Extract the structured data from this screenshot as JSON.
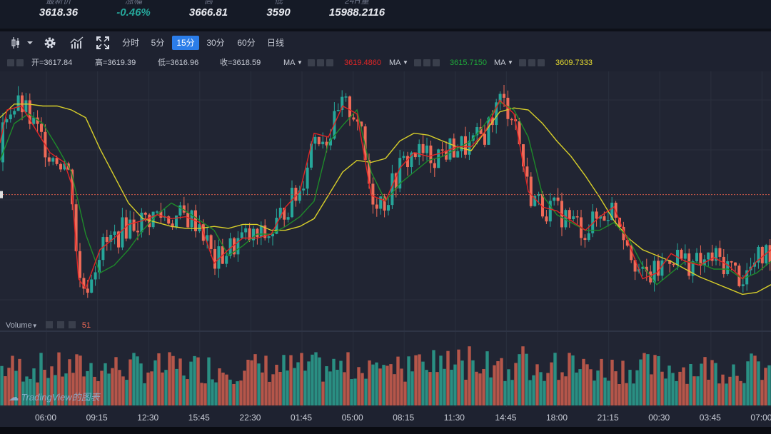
{
  "stats": [
    {
      "label": "最新价",
      "value": "3618.36",
      "cls": ""
    },
    {
      "label": "涨幅",
      "value": "-0.46%",
      "cls": "neg"
    },
    {
      "label": "高",
      "value": "3666.81",
      "cls": ""
    },
    {
      "label": "低",
      "value": "3590",
      "cls": ""
    },
    {
      "label": "24H量",
      "value": "15988.2116",
      "cls": ""
    }
  ],
  "toolbar": {
    "intervals": [
      "分时",
      "5分",
      "15分",
      "30分",
      "60分",
      "日线"
    ],
    "active_index": 2
  },
  "legend": {
    "open": "开=3617.84",
    "high": "高=3619.39",
    "low": "低=3616.96",
    "close": "收=3618.59",
    "ma_label": "MA",
    "ma1_value": "3619.4860",
    "ma2_value": "3615.7150",
    "ma3_value": "3609.7333"
  },
  "volume_legend": {
    "label": "Volume",
    "value": "51"
  },
  "watermark": "TradingView的图表",
  "colors": {
    "up": "#26a69a",
    "down": "#ef6a57",
    "ma1": "#e02626",
    "ma2": "#1e8a2a",
    "ma3": "#d8cf2a",
    "active_tab": "#2b7de9",
    "vol_up": "#2a8f83",
    "vol_down": "#b5564a"
  },
  "chart_data": {
    "type": "candlestick",
    "x_ticks": [
      "06:00",
      "09:15",
      "12:30",
      "15:45",
      "22:30",
      "01:45",
      "05:00",
      "08:15",
      "11:30",
      "14:45",
      "18:00",
      "21:15",
      "00:30",
      "03:45",
      "07:00"
    ],
    "ylim": [
      3555,
      3680
    ],
    "current_price": 3618.36,
    "ma1_path": [
      [
        0,
        3645
      ],
      [
        10,
        3662
      ],
      [
        30,
        3664
      ],
      [
        50,
        3652
      ],
      [
        70,
        3640
      ],
      [
        90,
        3635
      ],
      [
        100,
        3624
      ],
      [
        110,
        3575
      ],
      [
        120,
        3570
      ],
      [
        140,
        3590
      ],
      [
        160,
        3596
      ],
      [
        180,
        3603
      ],
      [
        200,
        3605
      ],
      [
        220,
        3608
      ],
      [
        240,
        3606
      ],
      [
        260,
        3607
      ],
      [
        280,
        3604
      ],
      [
        300,
        3583
      ],
      [
        320,
        3590
      ],
      [
        340,
        3596
      ],
      [
        360,
        3596
      ],
      [
        380,
        3598
      ],
      [
        400,
        3612
      ],
      [
        420,
        3620
      ],
      [
        440,
        3650
      ],
      [
        460,
        3648
      ],
      [
        480,
        3664
      ],
      [
        500,
        3660
      ],
      [
        520,
        3618
      ],
      [
        540,
        3615
      ],
      [
        560,
        3632
      ],
      [
        580,
        3640
      ],
      [
        600,
        3638
      ],
      [
        620,
        3640
      ],
      [
        640,
        3643
      ],
      [
        660,
        3643
      ],
      [
        680,
        3651
      ],
      [
        700,
        3667
      ],
      [
        720,
        3660
      ],
      [
        740,
        3620
      ],
      [
        760,
        3612
      ],
      [
        780,
        3610
      ],
      [
        800,
        3605
      ],
      [
        820,
        3600
      ],
      [
        840,
        3607
      ],
      [
        860,
        3612
      ],
      [
        880,
        3594
      ],
      [
        900,
        3575
      ],
      [
        920,
        3578
      ],
      [
        940,
        3588
      ],
      [
        960,
        3584
      ],
      [
        980,
        3582
      ],
      [
        1000,
        3586
      ],
      [
        1020,
        3582
      ],
      [
        1040,
        3575
      ],
      [
        1060,
        3584
      ],
      [
        1080,
        3590
      ]
    ],
    "ma2_path": [
      [
        0,
        3636
      ],
      [
        20,
        3655
      ],
      [
        40,
        3660
      ],
      [
        60,
        3655
      ],
      [
        80,
        3643
      ],
      [
        100,
        3630
      ],
      [
        120,
        3598
      ],
      [
        140,
        3578
      ],
      [
        160,
        3582
      ],
      [
        180,
        3590
      ],
      [
        200,
        3600
      ],
      [
        220,
        3608
      ],
      [
        240,
        3614
      ],
      [
        260,
        3610
      ],
      [
        280,
        3605
      ],
      [
        300,
        3600
      ],
      [
        320,
        3587
      ],
      [
        340,
        3592
      ],
      [
        360,
        3598
      ],
      [
        380,
        3598
      ],
      [
        400,
        3602
      ],
      [
        420,
        3607
      ],
      [
        440,
        3615
      ],
      [
        460,
        3645
      ],
      [
        480,
        3654
      ],
      [
        500,
        3662
      ],
      [
        520,
        3630
      ],
      [
        540,
        3615
      ],
      [
        560,
        3624
      ],
      [
        580,
        3630
      ],
      [
        600,
        3636
      ],
      [
        620,
        3638
      ],
      [
        640,
        3642
      ],
      [
        660,
        3646
      ],
      [
        680,
        3655
      ],
      [
        700,
        3666
      ],
      [
        720,
        3662
      ],
      [
        740,
        3648
      ],
      [
        760,
        3618
      ],
      [
        780,
        3608
      ],
      [
        800,
        3604
      ],
      [
        820,
        3600
      ],
      [
        840,
        3600
      ],
      [
        860,
        3604
      ],
      [
        880,
        3596
      ],
      [
        900,
        3582
      ],
      [
        920,
        3572
      ],
      [
        940,
        3578
      ],
      [
        960,
        3584
      ],
      [
        980,
        3583
      ],
      [
        1000,
        3580
      ],
      [
        1020,
        3580
      ],
      [
        1040,
        3575
      ],
      [
        1060,
        3578
      ],
      [
        1080,
        3584
      ]
    ],
    "ma3_path": [
      [
        0,
        3658
      ],
      [
        20,
        3665
      ],
      [
        40,
        3665
      ],
      [
        60,
        3664
      ],
      [
        80,
        3664
      ],
      [
        100,
        3662
      ],
      [
        120,
        3658
      ],
      [
        140,
        3642
      ],
      [
        160,
        3628
      ],
      [
        180,
        3614
      ],
      [
        200,
        3606
      ],
      [
        220,
        3604
      ],
      [
        240,
        3602
      ],
      [
        260,
        3601
      ],
      [
        280,
        3601
      ],
      [
        300,
        3602
      ],
      [
        320,
        3601
      ],
      [
        340,
        3603
      ],
      [
        360,
        3603
      ],
      [
        380,
        3600
      ],
      [
        400,
        3600
      ],
      [
        420,
        3602
      ],
      [
        440,
        3606
      ],
      [
        460,
        3618
      ],
      [
        480,
        3630
      ],
      [
        500,
        3636
      ],
      [
        520,
        3635
      ],
      [
        540,
        3637
      ],
      [
        560,
        3646
      ],
      [
        580,
        3650
      ],
      [
        600,
        3649
      ],
      [
        620,
        3646
      ],
      [
        640,
        3643
      ],
      [
        660,
        3641
      ],
      [
        680,
        3651
      ],
      [
        700,
        3661
      ],
      [
        720,
        3663
      ],
      [
        740,
        3662
      ],
      [
        760,
        3655
      ],
      [
        780,
        3646
      ],
      [
        800,
        3638
      ],
      [
        820,
        3628
      ],
      [
        840,
        3617
      ],
      [
        860,
        3605
      ],
      [
        880,
        3596
      ],
      [
        900,
        3590
      ],
      [
        920,
        3587
      ],
      [
        940,
        3584
      ],
      [
        960,
        3580
      ],
      [
        980,
        3576
      ],
      [
        1000,
        3573
      ],
      [
        1020,
        3570
      ],
      [
        1040,
        3567
      ],
      [
        1060,
        3568
      ],
      [
        1080,
        3572
      ]
    ]
  }
}
